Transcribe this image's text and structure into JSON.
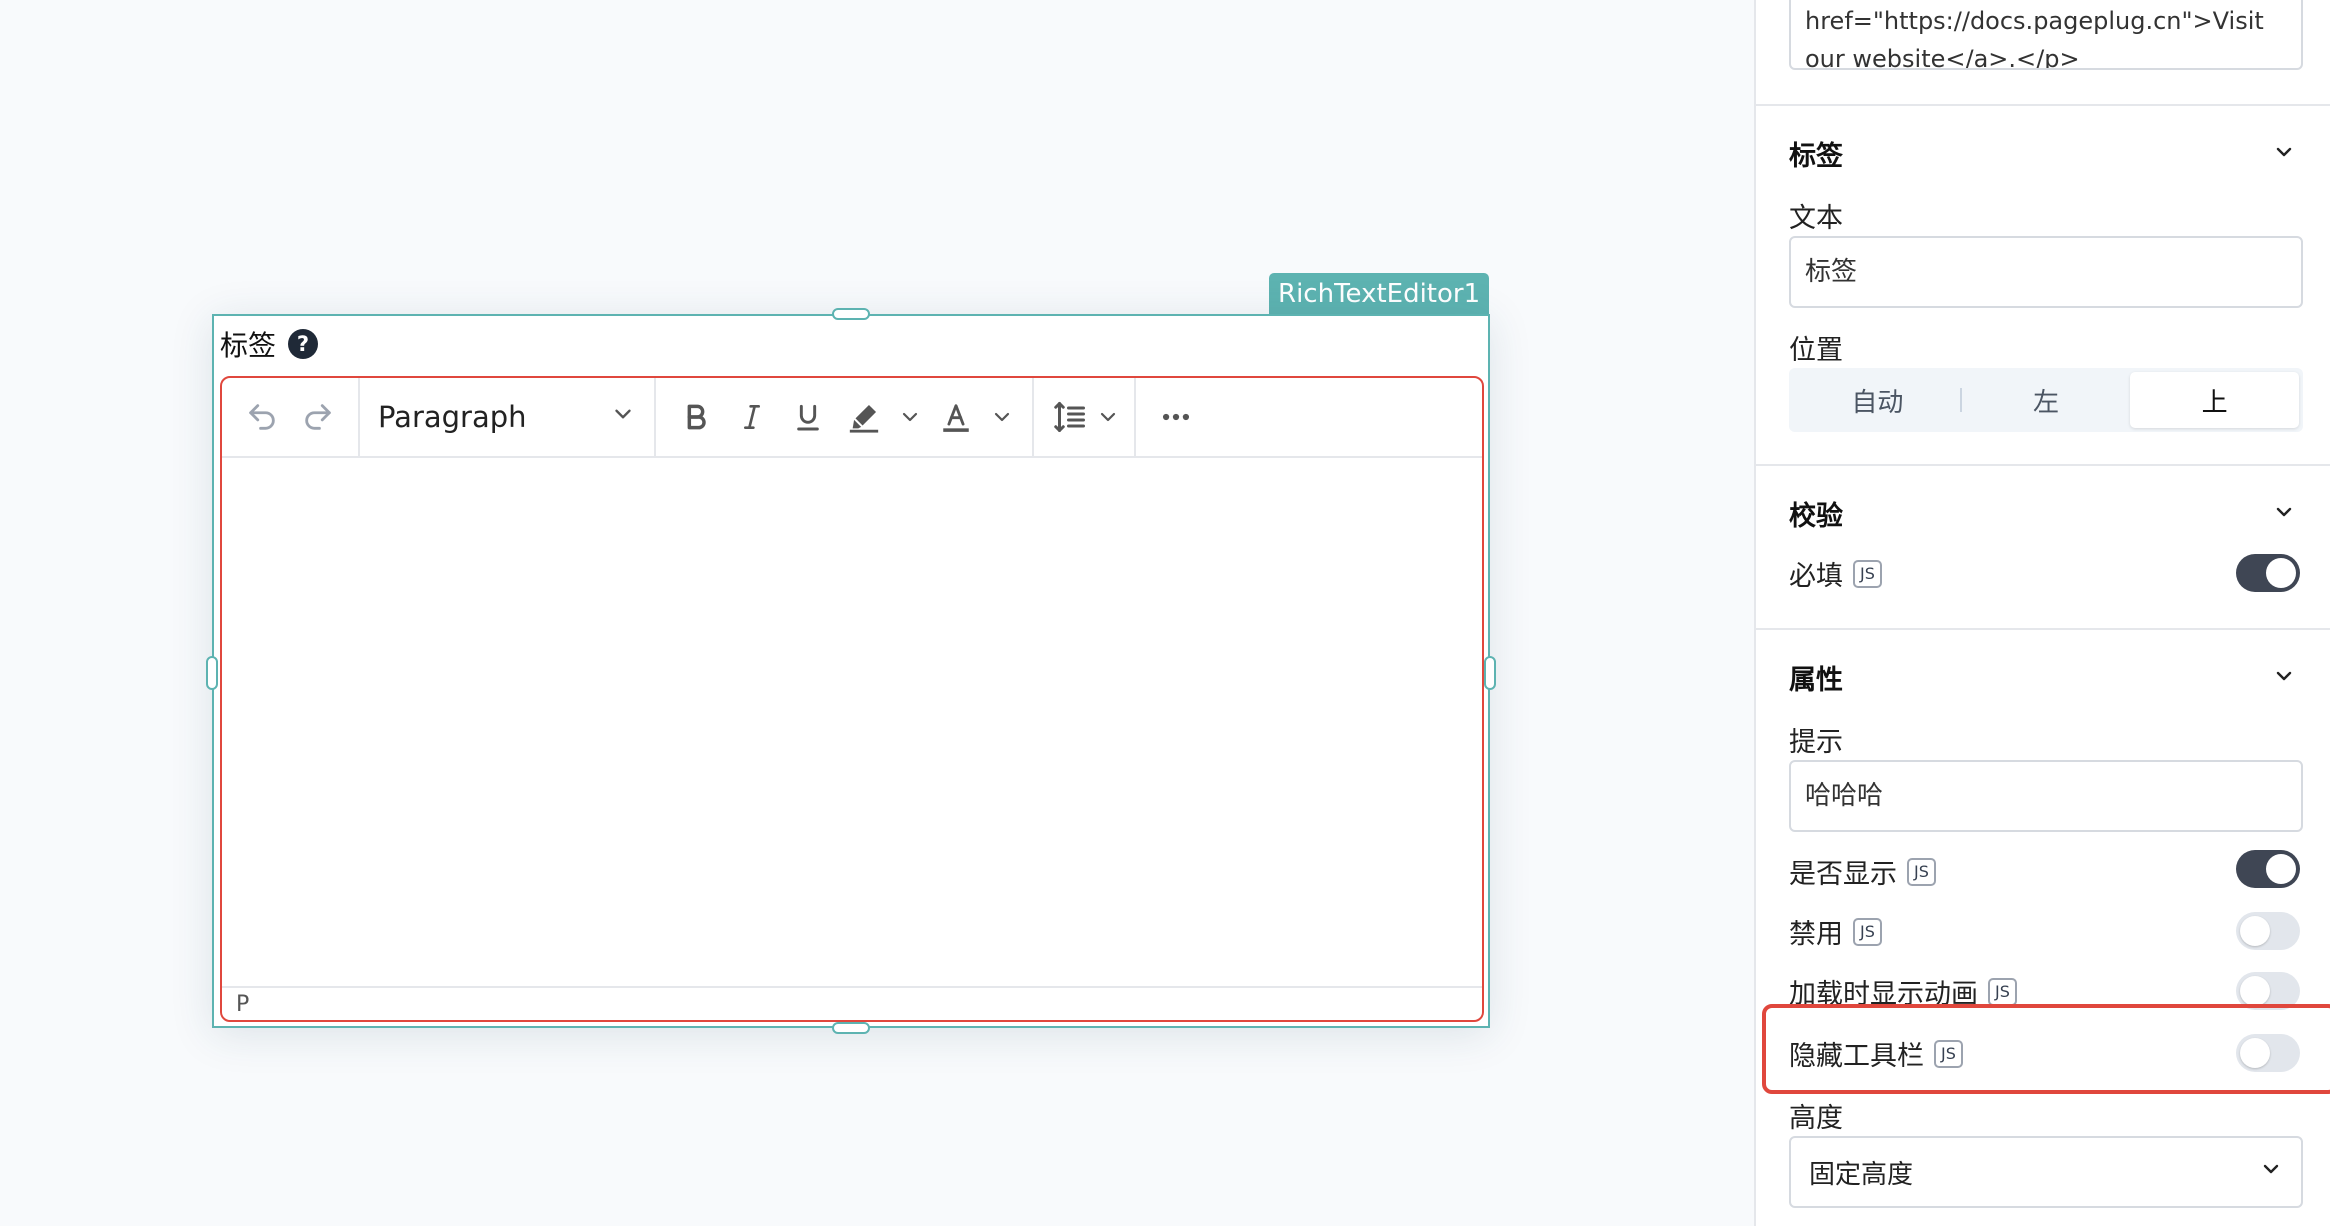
{
  "canvas": {
    "widget_name": "RichTextEditor1",
    "field_label": "标签",
    "help_icon_glyph": "?",
    "editor": {
      "toolbar": {
        "undo_icon": "undo-icon",
        "redo_icon": "redo-icon",
        "block_format": "Paragraph",
        "bold_icon": "bold-icon",
        "italic_icon": "italic-icon",
        "underline_icon": "underline-icon",
        "highlight_icon": "highlighter-icon",
        "text_color_icon": "text-color-icon",
        "line_height_icon": "line-height-icon",
        "more_icon": "more-icon"
      },
      "statusbar_path": "P",
      "accent_color": "#e0473d"
    },
    "selection_color": "#5db3b1"
  },
  "panel": {
    "html_default_value_lines": [
      "href=\"https://docs.pageplug.cn\">Visit",
      "our website</a>.</p>"
    ],
    "sections": {
      "label": {
        "title": "标签",
        "text_label": "文本",
        "text_value": "标签",
        "position_label": "位置",
        "position_options": [
          "自动",
          "左",
          "上"
        ],
        "position_selected": "上"
      },
      "validation": {
        "title": "校验",
        "required_label": "必填",
        "required_on": true
      },
      "properties": {
        "title": "属性",
        "tooltip_label": "提示",
        "tooltip_value": "哈哈哈",
        "visible_label": "是否显示",
        "visible_on": true,
        "disabled_label": "禁用",
        "disabled_on": false,
        "animate_loading_label": "加载时显示动画",
        "animate_loading_on": false,
        "hide_toolbar_label": "隐藏工具栏",
        "hide_toolbar_on": false,
        "height_label": "高度",
        "height_value": "固定高度"
      }
    },
    "js_badge": "JS",
    "highlight_color": "#e0473d"
  }
}
